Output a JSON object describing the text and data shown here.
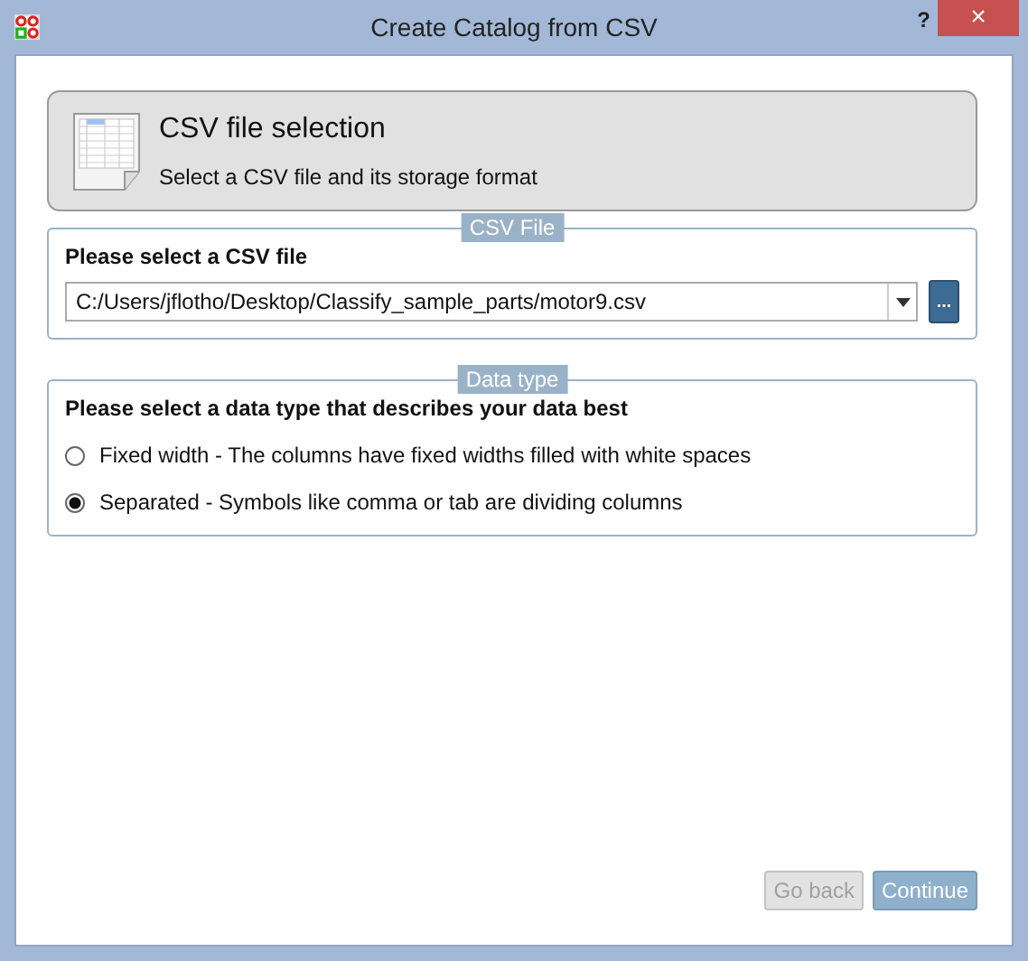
{
  "window": {
    "title": "Create Catalog from CSV",
    "help": "?",
    "close": "×"
  },
  "header": {
    "title": "CSV file selection",
    "subtitle": "Select a CSV file and its storage format"
  },
  "file_group": {
    "legend": "CSV File",
    "label": "Please select a CSV file",
    "path": "C:/Users/jflotho/Desktop/Classify_sample_parts/motor9.csv",
    "browse": "..."
  },
  "type_group": {
    "legend": "Data type",
    "label": "Please select a data type that describes your data best",
    "options": [
      {
        "label": "Fixed width - The columns have fixed widths filled with white spaces",
        "selected": false
      },
      {
        "label": "Separated - Symbols like comma or tab are dividing columns",
        "selected": true
      }
    ]
  },
  "buttons": [
    {
      "label": "Go back",
      "disabled": true
    },
    {
      "label": "Continue",
      "disabled": false
    }
  ]
}
